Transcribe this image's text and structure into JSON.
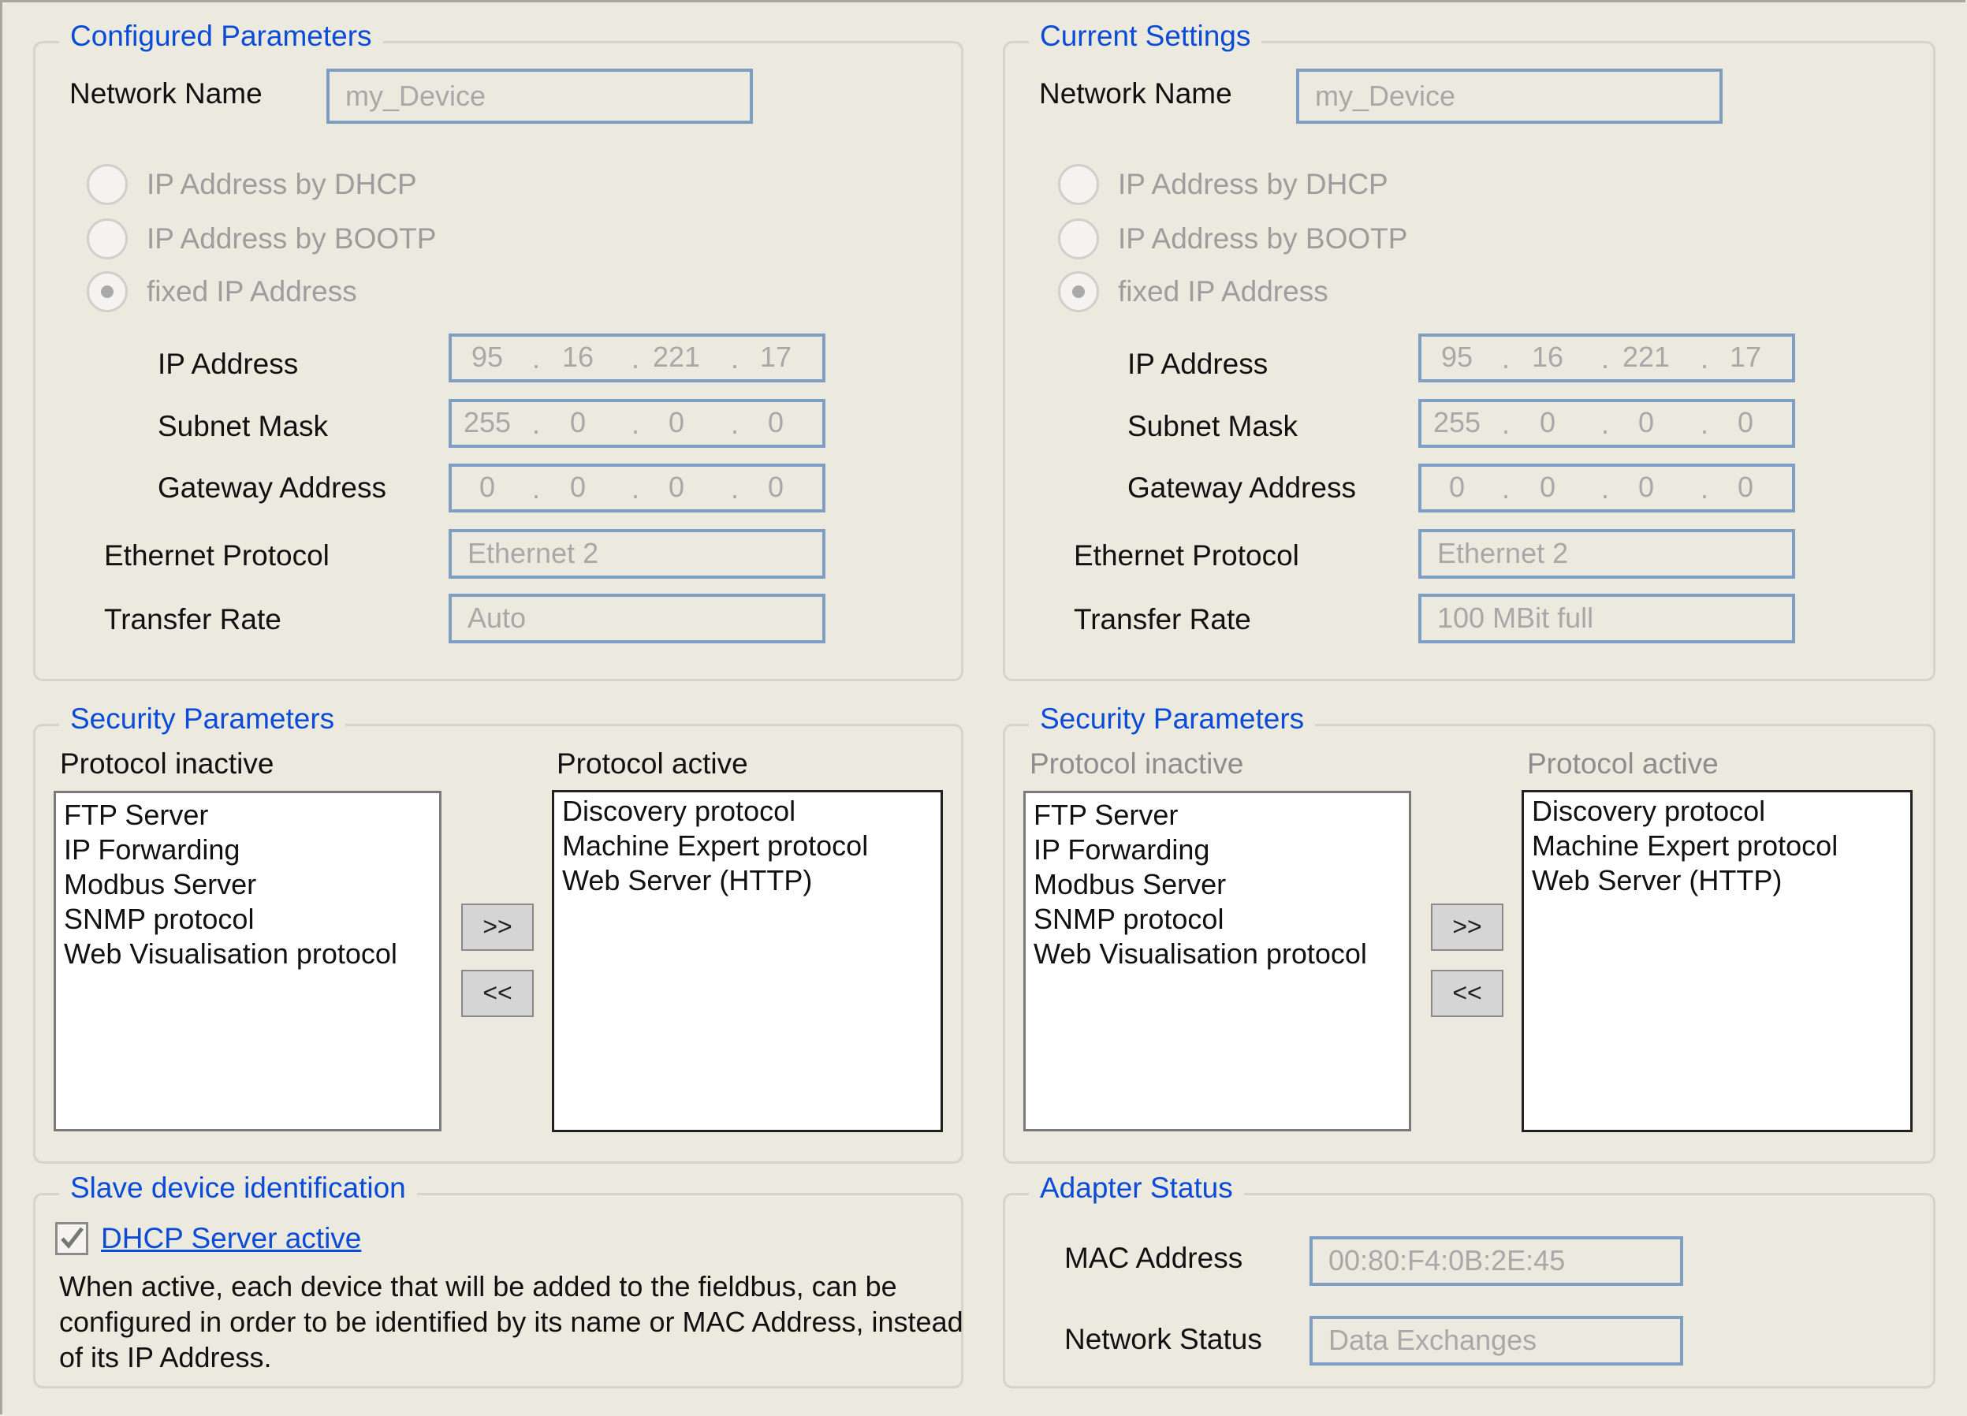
{
  "configured": {
    "legend": "Configured Parameters",
    "network_name_label": "Network Name",
    "network_name_value": "my_Device",
    "radio_dhcp": "IP Address by DHCP",
    "radio_bootp": "IP Address by BOOTP",
    "radio_fixed": "fixed IP Address",
    "selected_radio": "fixed IP Address",
    "ip_label": "IP Address",
    "ip": [
      "95",
      "16",
      "221",
      "17"
    ],
    "subnet_label": "Subnet Mask",
    "subnet": [
      "255",
      "0",
      "0",
      "0"
    ],
    "gateway_label": "Gateway Address",
    "gateway": [
      "0",
      "0",
      "0",
      "0"
    ],
    "eth_label": "Ethernet Protocol",
    "eth_value": "Ethernet 2",
    "rate_label": "Transfer Rate",
    "rate_value": "Auto"
  },
  "current": {
    "legend": "Current Settings",
    "network_name_label": "Network Name",
    "network_name_value": "my_Device",
    "radio_dhcp": "IP Address by DHCP",
    "radio_bootp": "IP Address by BOOTP",
    "radio_fixed": "fixed IP Address",
    "selected_radio": "fixed IP Address",
    "ip_label": "IP Address",
    "ip": [
      "95",
      "16",
      "221",
      "17"
    ],
    "subnet_label": "Subnet Mask",
    "subnet": [
      "255",
      "0",
      "0",
      "0"
    ],
    "gateway_label": "Gateway Address",
    "gateway": [
      "0",
      "0",
      "0",
      "0"
    ],
    "eth_label": "Ethernet Protocol",
    "eth_value": "Ethernet 2",
    "rate_label": "Transfer Rate",
    "rate_value": "100 MBit full"
  },
  "security_left": {
    "legend": "Security Parameters",
    "inactive_label": "Protocol inactive",
    "active_label": "Protocol active",
    "inactive_items": [
      "FTP Server",
      "IP Forwarding",
      "Modbus Server",
      "SNMP protocol",
      "Web Visualisation protocol"
    ],
    "active_items": [
      "Discovery protocol",
      "Machine Expert protocol",
      "Web Server (HTTP)"
    ],
    "move_right": ">>",
    "move_left": "<<"
  },
  "security_right": {
    "legend": "Security Parameters",
    "inactive_label": "Protocol inactive",
    "active_label": "Protocol active",
    "inactive_items": [
      "FTP Server",
      "IP Forwarding",
      "Modbus Server",
      "SNMP protocol",
      "Web Visualisation protocol"
    ],
    "active_items": [
      "Discovery protocol",
      "Machine Expert protocol",
      "Web Server (HTTP)"
    ],
    "move_right": ">>",
    "move_left": "<<"
  },
  "slave": {
    "legend": "Slave device identification",
    "dhcp_server_label": "DHCP Server active",
    "dhcp_server_checked": true,
    "description": "When active, each device that will be added to the fieldbus, can be configured in order to be identified by its name or MAC Address, instead of its IP Address."
  },
  "adapter": {
    "legend": "Adapter Status",
    "mac_label": "MAC Address",
    "mac_value": "00:80:F4:0B:2E:45",
    "status_label": "Network Status",
    "status_value": "Data Exchanges"
  },
  "colors": {
    "background": "#ece9de",
    "legend": "#0a4bd8",
    "field_border": "#7f9ec4"
  }
}
